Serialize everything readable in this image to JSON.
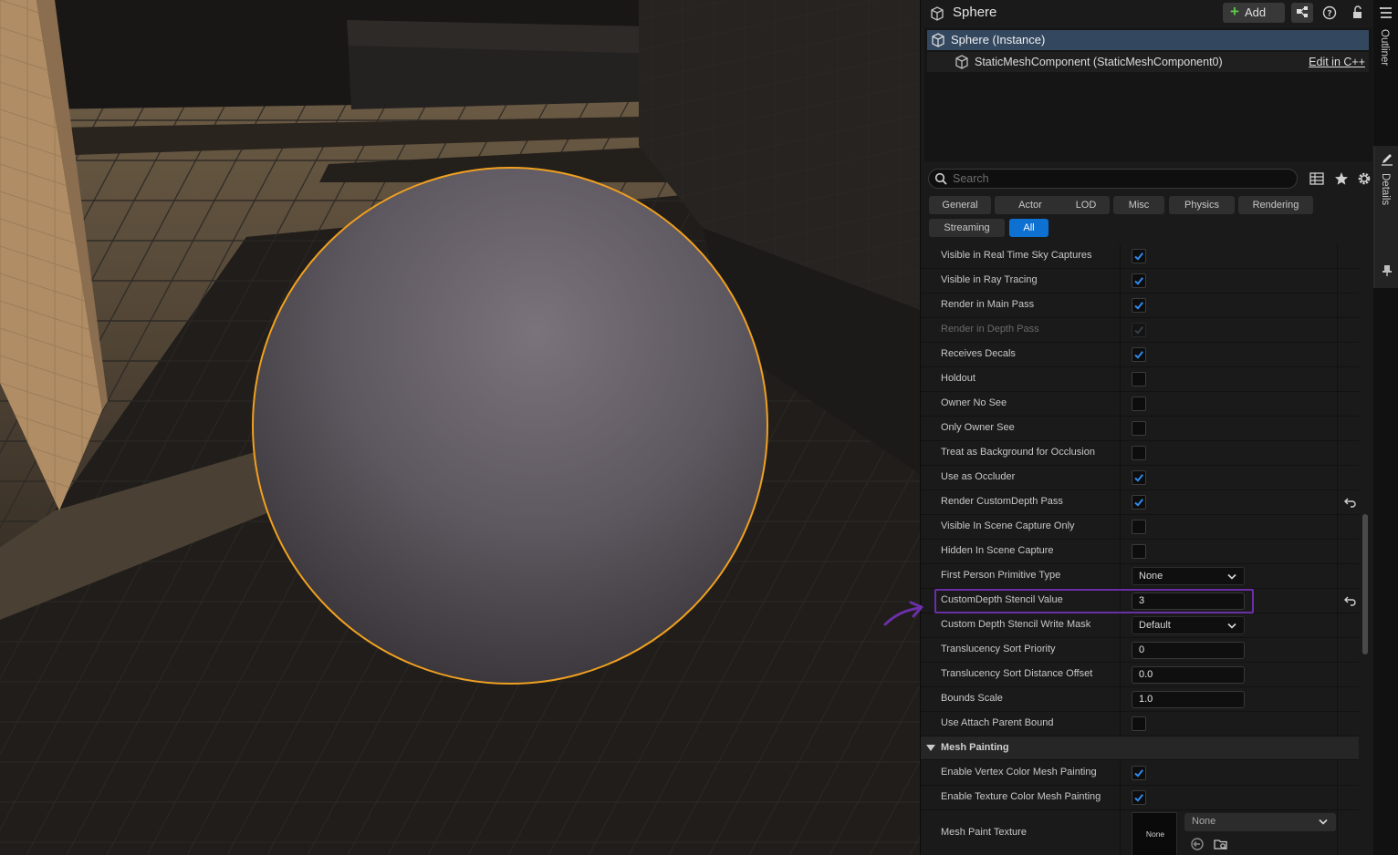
{
  "header": {
    "title": "Sphere",
    "add_label": "Add"
  },
  "tree": {
    "root_label": "Sphere (Instance)",
    "component_label": "StaticMeshComponent (StaticMeshComponent0)",
    "edit_link": "Edit in C++"
  },
  "search": {
    "placeholder": "Search",
    "value": ""
  },
  "tabs": [
    "General",
    "Actor",
    "LOD",
    "Misc",
    "Physics",
    "Rendering",
    "Streaming",
    "All"
  ],
  "active_tab": "All",
  "properties": {
    "p0": {
      "label": "Visible in Real Time Sky Captures",
      "checked": true
    },
    "p1": {
      "label": "Visible in Ray Tracing",
      "checked": true
    },
    "p2": {
      "label": "Render in Main Pass",
      "checked": true
    },
    "p3": {
      "label": "Render in Depth Pass",
      "checked": true,
      "disabled": true
    },
    "p4": {
      "label": "Receives Decals",
      "checked": true
    },
    "p5": {
      "label": "Holdout",
      "checked": false
    },
    "p6": {
      "label": "Owner No See",
      "checked": false
    },
    "p7": {
      "label": "Only Owner See",
      "checked": false
    },
    "p8": {
      "label": "Treat as Background for Occlusion",
      "checked": false
    },
    "p9": {
      "label": "Use as Occluder",
      "checked": true
    },
    "p10": {
      "label": "Render CustomDepth Pass",
      "checked": true
    },
    "p11": {
      "label": "Visible In Scene Capture Only",
      "checked": false
    },
    "p12": {
      "label": "Hidden In Scene Capture",
      "checked": false
    },
    "p13": {
      "label": "First Person Primitive Type",
      "value": "None"
    },
    "p14": {
      "label": "CustomDepth Stencil Value",
      "value": "3"
    },
    "p15": {
      "label": "Custom Depth Stencil Write Mask",
      "value": "Default"
    },
    "p16": {
      "label": "Translucency Sort Priority",
      "value": "0"
    },
    "p17": {
      "label": "Translucency Sort Distance Offset",
      "value": "0.0"
    },
    "p18": {
      "label": "Bounds Scale",
      "value": "1.0"
    },
    "p19": {
      "label": "Use Attach Parent Bound",
      "checked": false
    }
  },
  "mesh_painting": {
    "category": "Mesh Painting",
    "vertex": {
      "label": "Enable Vertex Color Mesh Painting",
      "checked": true
    },
    "texture": {
      "label": "Enable Texture Color Mesh Painting",
      "checked": true
    },
    "paint_texture": {
      "label": "Mesh Paint Texture",
      "thumb_text": "None",
      "value": "None"
    }
  },
  "dock": {
    "outliner": "Outliner",
    "details": "Details"
  },
  "colors": {
    "accent": "#0e70d1",
    "selection_outline": "#f0a020",
    "highlight_box": "#6b2fa8"
  }
}
